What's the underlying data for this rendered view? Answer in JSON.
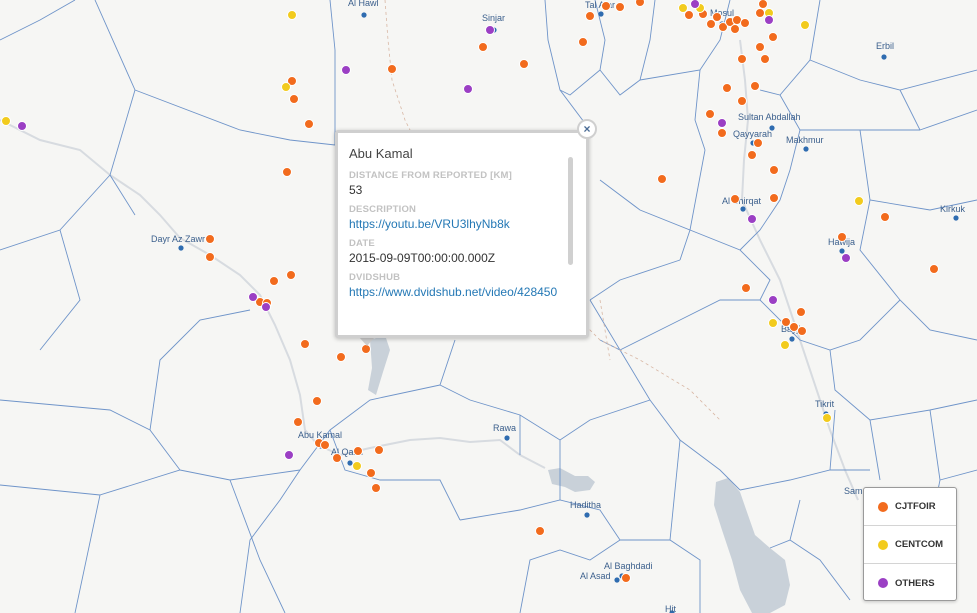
{
  "popup": {
    "title": "Abu Kamal",
    "fields": [
      {
        "label": "DISTANCE FROM REPORTED [KM]",
        "value": "53"
      },
      {
        "label": "DESCRIPTION",
        "value": "https://youtu.be/VRU3lhyNb8k"
      },
      {
        "label": "DATE",
        "value": "2015-09-09T00:00:00.000Z"
      },
      {
        "label": "DVIDSHUB",
        "value": "https://www.dvidshub.net/video/428450"
      }
    ],
    "close_glyph": "×"
  },
  "legend": {
    "items": [
      {
        "label": "CJTFOIR",
        "color": "#f26b1d"
      },
      {
        "label": "CENTCOM",
        "color": "#f2cb1d"
      },
      {
        "label": "OTHERS",
        "color": "#9b3fc4"
      }
    ]
  },
  "cities": [
    "Al Hawl",
    "Sinjar",
    "Tal Afar",
    "Mosul",
    "Erbil",
    "Sultan Abdallah",
    "Qayyarah",
    "Makhmur",
    "Al Shirqat",
    "Kirkuk",
    "Hawija",
    "Bayji",
    "Tikrit",
    "Dayr Az Zawr",
    "Abu Kamal",
    "Al Qaim",
    "Rawa",
    "Haditha",
    "Al Baghdadi",
    "Al Asad",
    "Sam",
    "Hit"
  ],
  "colors": {
    "cjtfoir": "#f26b1d",
    "centcom": "#f2cb1d",
    "others": "#9b3fc4",
    "city": "#2f6cb0",
    "region_line": "#6f94c9",
    "water": "#c9d1d9",
    "background": "#f6f6f4"
  }
}
